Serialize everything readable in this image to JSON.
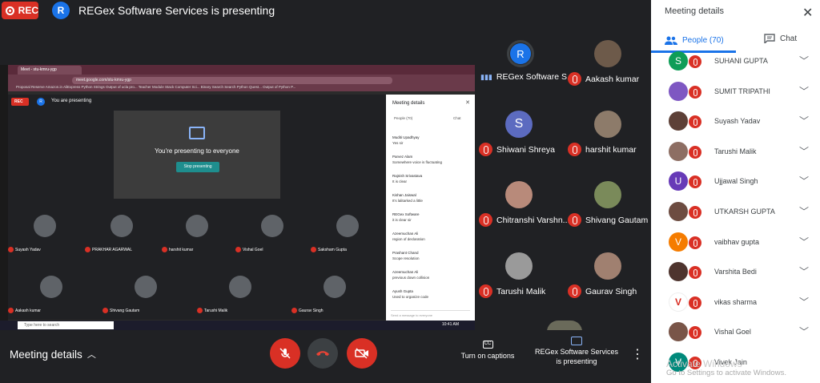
{
  "top": {
    "rec_label": "REC",
    "presenter_initial": "R",
    "presenting_title": "REGex Software Services is presenting"
  },
  "share": {
    "tab_title": "Meet - stu-kmru-ygp",
    "url": "meet.google.com/stu-kmru-ygp",
    "bookmarks": "Proposal Reserve   Amazon.in   AliExpress   Python Strings   Output of ucla pro...   Teacher Module   Stack Computer Sci...   Binary Search Search   Python Quest...   Output of Python P...",
    "inner_rec": "REC",
    "inner_av": "R",
    "inner_label": "You are presenting",
    "presenting_text": "You're presenting to everyone",
    "stop_label": "Stop presenting",
    "thumbs": [
      {
        "name": "Suyash Yadav"
      },
      {
        "name": "PRAKHAR AGARWAL"
      },
      {
        "name": "harshit kumar"
      },
      {
        "name": "Vishal Goel"
      },
      {
        "name": "Saksham Gupta"
      },
      {
        "name": "Aakash kumar"
      },
      {
        "name": "Shivang Gautam"
      },
      {
        "name": "Tarushi Malik"
      },
      {
        "name": "Gaurav Singh"
      }
    ],
    "details_title": "Meeting details",
    "details_people": "People (70)",
    "details_chat": "Chat",
    "messages": [
      {
        "who": "Muditi Upadhyay",
        "text": "Yes sir"
      },
      {
        "who": "Parvez Alam",
        "text": "Somewhere voice is fluctuating"
      },
      {
        "who": "Rajnish Srivastava",
        "text": "It is clear"
      },
      {
        "who": "Kishan Jaiswal",
        "text": "It's lalitarked a little"
      },
      {
        "who": "REGex Software",
        "text": "it is clear sir"
      },
      {
        "who": "Azeemuchan Ali",
        "text": "region of declaration"
      },
      {
        "who": "Prashant Chand",
        "text": "Scope resolution"
      },
      {
        "who": "Azeemuchan Ali",
        "text": "previous down collision"
      },
      {
        "who": "Ayush Gupta",
        "text": "Used to organize code"
      }
    ],
    "input_placeholder": "Send a message to everyone",
    "search_placeholder": "Type here to search",
    "clock": "10:41 AM"
  },
  "grid": [
    {
      "name": "REGex Software S...",
      "initial": "R",
      "muted": false
    },
    {
      "name": "Aakash kumar",
      "initial": "",
      "muted": true
    },
    {
      "name": "Shiwani Shreya",
      "initial": "S",
      "muted": true
    },
    {
      "name": "harshit kumar",
      "initial": "",
      "muted": true
    },
    {
      "name": "Chitranshi Varshn...",
      "initial": "",
      "muted": true
    },
    {
      "name": "Shivang Gautam",
      "initial": "",
      "muted": true
    },
    {
      "name": "Tarushi Malik",
      "initial": "",
      "muted": true
    },
    {
      "name": "Gaurav Singh",
      "initial": "",
      "muted": true
    }
  ],
  "bottom": {
    "meeting_details": "Meeting details",
    "captions": "Turn on captions",
    "captions_icon": "CC",
    "presenting_line1": "REGex Software Services",
    "presenting_line2": "is presenting"
  },
  "panel": {
    "title": "Meeting details",
    "tab_people": "People (70)",
    "tab_chat": "Chat",
    "people": [
      {
        "name": "SUHANI GUPTA",
        "initial": "S",
        "color": "#0f9d58"
      },
      {
        "name": "SUMIT TRIPATHI",
        "initial": "",
        "color": "#7e57c2"
      },
      {
        "name": "Suyash Yadav",
        "initial": "",
        "color": "#5d4037"
      },
      {
        "name": "Tarushi Malik",
        "initial": "",
        "color": "#8d6e63"
      },
      {
        "name": "Ujjawal Singh",
        "initial": "U",
        "color": "#673ab7"
      },
      {
        "name": "UTKARSH GUPTA",
        "initial": "",
        "color": "#6d4c41"
      },
      {
        "name": "vaibhav gupta",
        "initial": "V",
        "color": "#f57c00"
      },
      {
        "name": "Varshita Bedi",
        "initial": "",
        "color": "#4e342e"
      },
      {
        "name": "vikas sharma",
        "initial": "",
        "color": "#ffffff"
      },
      {
        "name": "Vishal Goel",
        "initial": "",
        "color": "#795548"
      },
      {
        "name": "Vivek Jain",
        "initial": "V",
        "color": "#00897b"
      }
    ],
    "watermark_line1": "Activate Windows",
    "watermark_line2": "Go to Settings to activate Windows."
  },
  "colors": {
    "accent": "#1a73e8",
    "danger": "#d93025",
    "bg": "#202124"
  }
}
